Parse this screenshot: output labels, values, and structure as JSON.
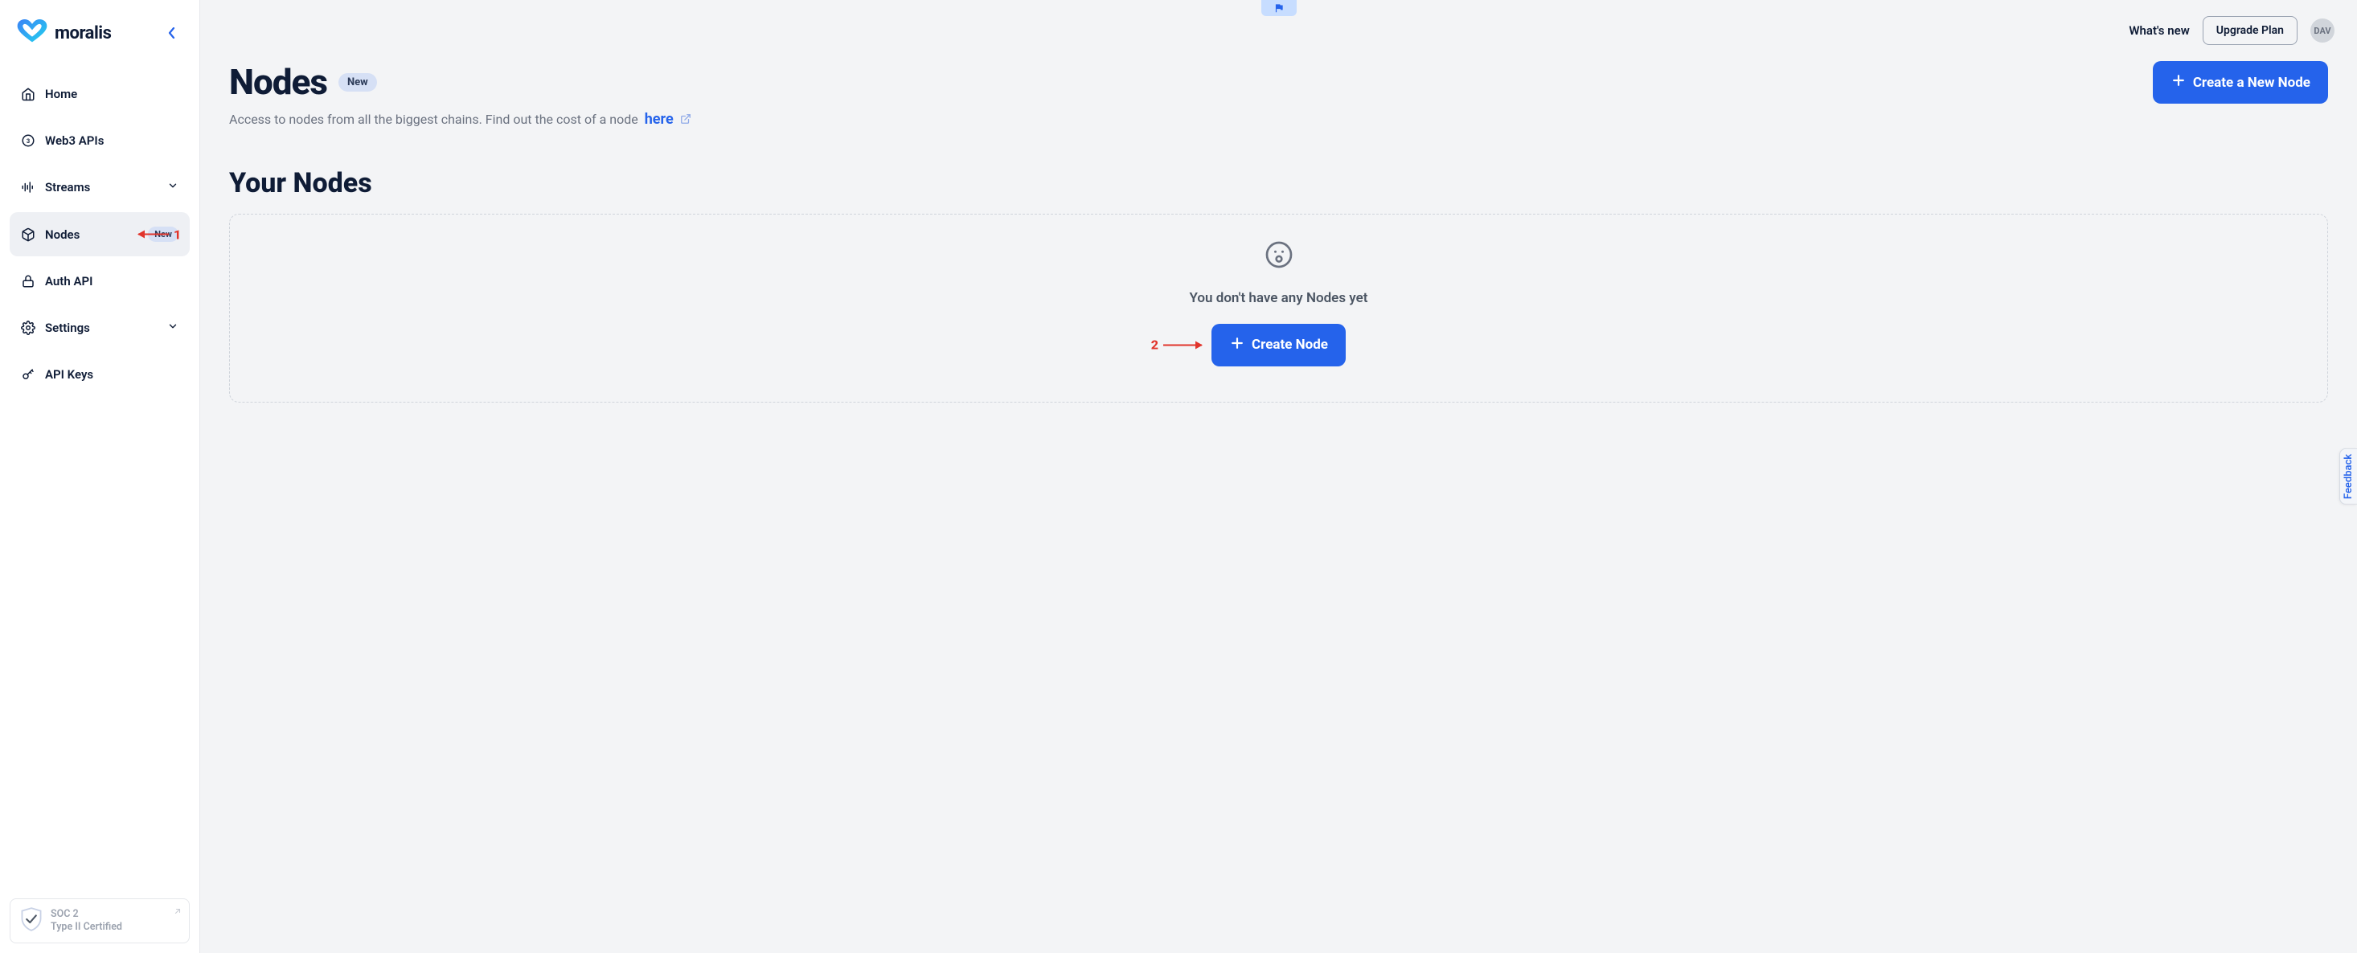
{
  "brand": {
    "name": "moralis"
  },
  "sidebar": {
    "items": [
      {
        "label": "Home"
      },
      {
        "label": "Web3 APIs"
      },
      {
        "label": "Streams"
      },
      {
        "label": "Nodes",
        "badge": "New"
      },
      {
        "label": "Auth API"
      },
      {
        "label": "Settings"
      },
      {
        "label": "API Keys"
      }
    ],
    "soc": {
      "line1": "SOC 2",
      "line2": "Type II Certified"
    }
  },
  "topbar": {
    "whatsnew": "What's new",
    "upgrade": "Upgrade Plan",
    "avatar": "DAV"
  },
  "page": {
    "title": "Nodes",
    "title_badge": "New",
    "subtitle": "Access to nodes from all the biggest chains. Find out the cost of a node",
    "here_label": "here",
    "create_top_btn": "Create a New Node",
    "section_title": "Your Nodes",
    "empty_text": "You don't have any Nodes yet",
    "create_btn": "Create Node"
  },
  "annotations": {
    "one": "1",
    "two": "2"
  },
  "feedback": {
    "label": "Feedback"
  }
}
